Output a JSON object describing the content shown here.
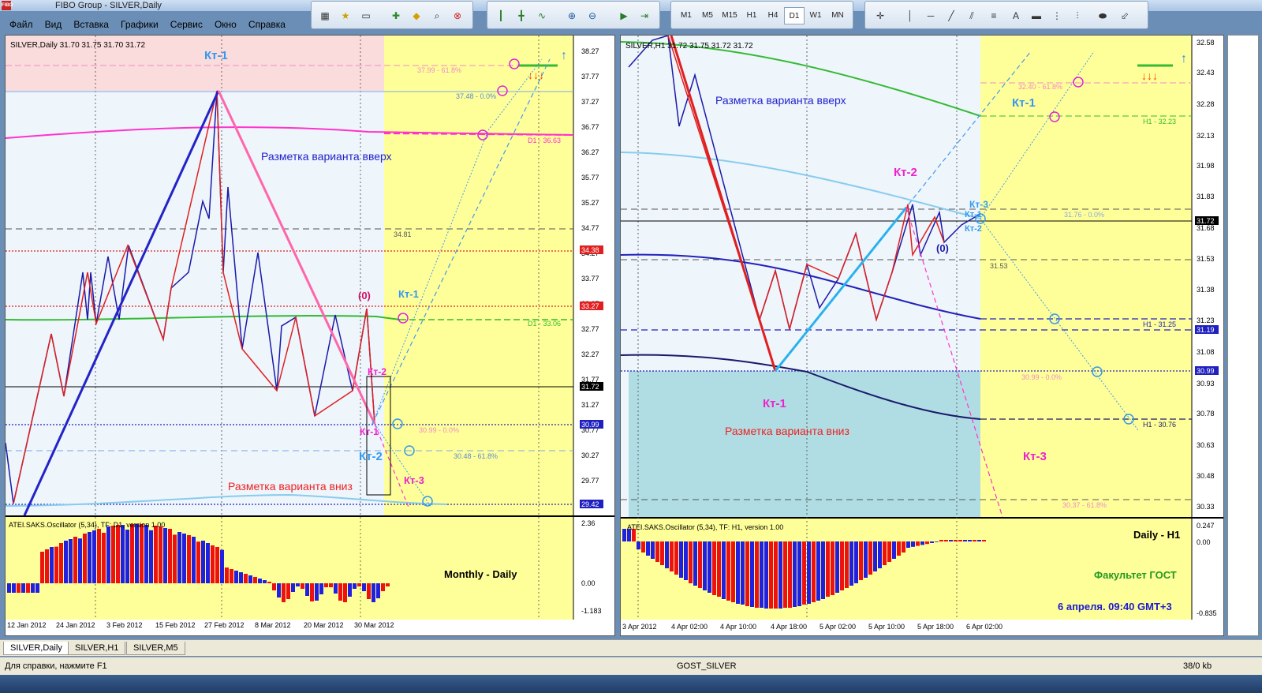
{
  "window": {
    "title": "FIBO Group - SILVER,Daily"
  },
  "menu": [
    "Файл",
    "Вид",
    "Вставка",
    "Графики",
    "Сервис",
    "Окно",
    "Справка"
  ],
  "toolbar": {
    "timeframes": [
      "M1",
      "M5",
      "M15",
      "H1",
      "H4",
      "D1",
      "W1",
      "MN"
    ],
    "active_timeframe": "D1"
  },
  "left_chart": {
    "header": "SILVER,Daily  31.70 31.75 31.70 31.72",
    "price_labels": [
      "38.27",
      "37.77",
      "37.27",
      "36.77",
      "36.27",
      "35.77",
      "35.27",
      "34.77",
      "34.27",
      "33.77",
      "33.27",
      "32.77",
      "32.27",
      "31.77",
      "31.27",
      "30.77",
      "30.27",
      "29.77",
      "29.27"
    ],
    "badges": [
      {
        "text": "34.38",
        "color": "#e02020"
      },
      {
        "text": "33.27",
        "color": "#e02020"
      },
      {
        "text": "31.72",
        "color": "#000000"
      },
      {
        "text": "30.99",
        "color": "#2020c0"
      },
      {
        "text": "29.42",
        "color": "#2020c0"
      }
    ],
    "labels": {
      "kt1_top": "Кт-1",
      "up_text": "Разметка варианта вверх",
      "down_text": "Разметка варианта вниз",
      "zero": "(0)",
      "kt1_blue": "Кт-1",
      "kt2_magenta": "Кт-2",
      "kt1_magenta": "Кт-1",
      "kt2_blue": "Кт-2",
      "kt3_magenta": "Кт-3"
    },
    "levels": {
      "l3799": "37.99 - 61.8%",
      "l3748": "37.48 - 0.0%",
      "d1_3663": "D1 - 36.63",
      "l3481": "34.81",
      "d1_3306": "D1 - 33.06",
      "l3099": "30.99 - 0.0%",
      "l3048": "30.48 - 61.8%"
    },
    "osc_header": "ATEI.SAKS.Oscillator (5,34), TF: D1, version 1.00",
    "osc_scale": [
      "2.36",
      "0.00",
      "-1.183"
    ],
    "osc_label": "Monthly - Daily",
    "dates": [
      "12 Jan 2012",
      "24 Jan 2012",
      "3 Feb 2012",
      "15 Feb 2012",
      "27 Feb 2012",
      "8 Mar 2012",
      "20 Mar 2012",
      "30 Mar 2012"
    ]
  },
  "right_chart": {
    "header": "SILVER,H1  31.72 31.75 31.72 31.72",
    "price_labels": [
      "32.58",
      "32.43",
      "32.28",
      "32.13",
      "31.98",
      "31.83",
      "31.68",
      "31.53",
      "31.38",
      "31.23",
      "31.08",
      "30.93",
      "30.78",
      "30.63",
      "30.48",
      "30.33"
    ],
    "badges": [
      {
        "text": "31.72",
        "color": "#000000"
      },
      {
        "text": "31.19",
        "color": "#2020c0"
      },
      {
        "text": "30.99",
        "color": "#2020c0"
      }
    ],
    "labels": {
      "up_text": "Разметка варианта вверх",
      "kt1_blue": "Кт-1",
      "kt2_magenta": "Кт-2",
      "kt3_blue": "Кт-3",
      "kt1_small": "Кт-1",
      "kt2_small": "Кт-2",
      "zero": "(0)",
      "kt1_magenta": "Кт-1",
      "down_text": "Разметка варианта вниз",
      "kt3_magenta": "Кт-3"
    },
    "levels": {
      "l3240": "32.40 - 61.8%",
      "h1_3223": "H1 - 32.23",
      "l3176": "31.76 - 0.0%",
      "l3153": "31.53",
      "h1_3125": "H1 - 31.25",
      "l3099": "30.99 - 0.0%",
      "h1_3076": "H1 - 30.76",
      "l3037": "30.37 - 61.8%"
    },
    "osc_header": "ATEI.SAKS.Oscillator (5,34), TF: H1, version 1.00",
    "osc_scale": [
      "0.247",
      "0.00",
      "-0.835"
    ],
    "osc_label1": "Daily - H1",
    "osc_label2": "Факультет ГОСТ",
    "osc_label3": "6 апреля. 09:40 GMT+3",
    "dates": [
      "3 Apr 2012",
      "4 Apr 02:00",
      "4 Apr 10:00",
      "4 Apr 18:00",
      "5 Apr 02:00",
      "5 Apr 10:00",
      "5 Apr 18:00",
      "6 Apr 02:00"
    ]
  },
  "tabs": [
    "SILVER,Daily",
    "SILVER,H1",
    "SILVER,M5"
  ],
  "active_tab": "SILVER,Daily",
  "status": {
    "help": "Для справки, нажмите F1",
    "profile": "GOST_SILVER",
    "traffic": "38/0 kb"
  }
}
